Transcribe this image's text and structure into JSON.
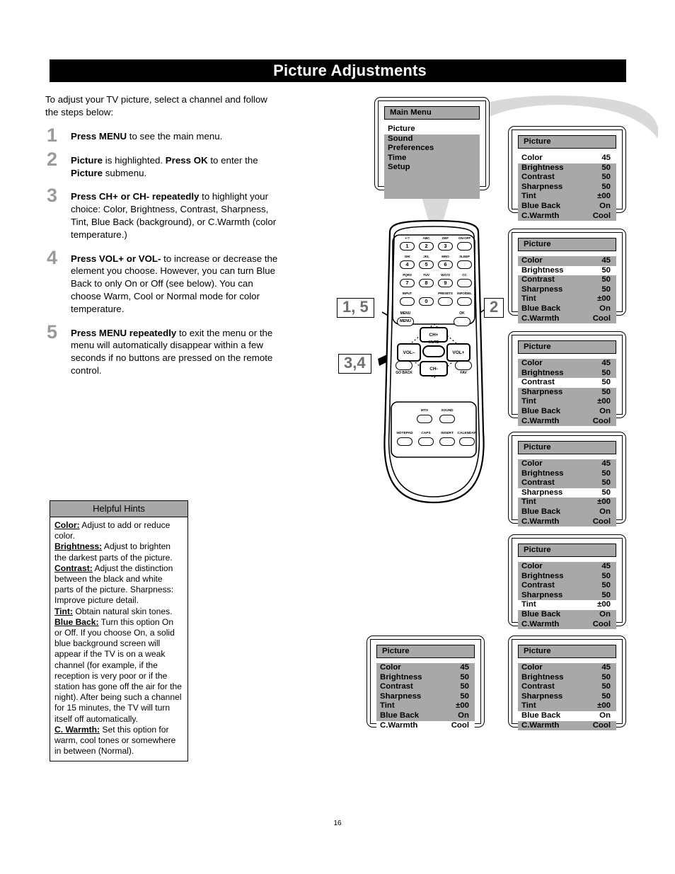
{
  "header": {
    "title": "Picture Adjustments"
  },
  "page": {
    "number": "16"
  },
  "intro": "To adjust your TV picture, select a channel and follow the steps below:",
  "steps": [
    {
      "num": "1",
      "html": "<b>Press MENU</b> to see the main menu."
    },
    {
      "num": "2",
      "html": "<b>Picture</b> is highlighted. <b>Press OK</b> to enter the <b>Picture</b> submenu."
    },
    {
      "num": "3",
      "html": "<b>Press CH+ or CH- repeatedly</b> to highlight your choice: Color, Brightness, Contrast, Sharpness, Tint, Blue Back (background), or C.Warmth (color temperature.)"
    },
    {
      "num": "4",
      "html": "<b>Press VOL+ or VOL-</b> to increase or decrease the element you choose. However, you can turn Blue Back to only On or Off (see below). You can choose Warm, Cool or Normal mode for color temperature."
    },
    {
      "num": "5",
      "html": "<b>Press MENU repeatedly</b> to exit the menu or the menu will automatically disappear within a few seconds if no buttons are pressed on the remote control."
    }
  ],
  "hints": {
    "title": "Helpful Hints",
    "html": "<u>Color:</u> Adjust to add or reduce color.<br><u>Brightness:</u> Adjust to brighten the darkest parts of the picture.<br><u>Contrast:</u> Adjust the distinction between the black and white parts of the picture. Sharpness: Improve picture detail.<br><u>Tint:</u> Obtain natural skin tones.<br><u>Blue Back:</u> Turn this option On or Off. If you choose On, a solid blue background screen will appear if the TV is on a weak channel (for example, if the reception is very poor or if the station has gone off the air for the night). After being such a channel for 15 minutes, the TV will turn itself off automatically.<br><u>C. Warmth:</u> Set this option for warm, cool tones or somewhere in between (Normal)."
  },
  "main_menu": {
    "title": "Main Menu",
    "items": [
      {
        "label": "Picture",
        "selected": true
      },
      {
        "label": "Sound",
        "selected": false
      },
      {
        "label": "Preferences",
        "selected": false
      },
      {
        "label": "Time",
        "selected": false
      },
      {
        "label": "Setup",
        "selected": false
      }
    ]
  },
  "picture_menu": {
    "title": "Picture",
    "rows": [
      {
        "label": "Color",
        "value": "45"
      },
      {
        "label": "Brightness",
        "value": "50"
      },
      {
        "label": "Contrast",
        "value": "50"
      },
      {
        "label": "Sharpness",
        "value": "50"
      },
      {
        "label": "Tint",
        "value": "±00"
      },
      {
        "label": "Blue Back",
        "value": "On"
      },
      {
        "label": "C.Warmth",
        "value": "Cool"
      }
    ]
  },
  "picture_screens": [
    {
      "id": "color",
      "selected_index": 0
    },
    {
      "id": "brightness",
      "selected_index": 1
    },
    {
      "id": "contrast",
      "selected_index": 2
    },
    {
      "id": "sharpness",
      "selected_index": 3
    },
    {
      "id": "tint",
      "selected_index": 4
    },
    {
      "id": "c-warmth",
      "selected_index": 6
    },
    {
      "id": "blue-back",
      "selected_index": 5
    }
  ],
  "callouts": [
    {
      "id": "steps-1-5",
      "label": "1, 5"
    },
    {
      "id": "step-2",
      "label": "2"
    },
    {
      "id": "steps-3-4",
      "label": "3,4"
    }
  ],
  "remote": {
    "keypad": [
      {
        "sub": "+-?",
        "key": "1"
      },
      {
        "sub": "ABC",
        "key": "2"
      },
      {
        "sub": "DEF",
        "key": "3"
      },
      {
        "sub": "ON·OFF",
        "key": ""
      },
      {
        "sub": "GHI",
        "key": "4"
      },
      {
        "sub": "JKL",
        "key": "5"
      },
      {
        "sub": "MNO",
        "key": "6"
      },
      {
        "sub": "SLEEP",
        "key": ""
      },
      {
        "sub": "PQRS",
        "key": "7"
      },
      {
        "sub": "TUV",
        "key": "8"
      },
      {
        "sub": "WXYZ",
        "key": "9"
      },
      {
        "sub": "CC",
        "key": ""
      },
      {
        "sub": "INPUT",
        "key": ""
      },
      {
        "sub": "",
        "key": "0"
      },
      {
        "sub": "PRESETS",
        "key": ""
      },
      {
        "sub": "INFO/DEL",
        "key": ""
      }
    ],
    "menu_label": "MENU",
    "ok_label": "OK",
    "ch_up_label": "CH+",
    "ch_down_label": "CH-",
    "vol_down_label": "VOL–",
    "vol_up_label": "VOL+",
    "mute_label": "MUTE",
    "go_back_label": "GO BACK",
    "fav_label": "FAV",
    "mts_label": "MTS",
    "sound_label": "SOUND",
    "notepad_label": "NOTEPAD",
    "caps_label": "CAPS",
    "insert_label": "INSERT",
    "calendar_label": "CALENDAR"
  },
  "colors": {
    "header_bg": "#000000",
    "osd_gray": "#a8a8a8",
    "step_number": "#9a9a9a",
    "deco_gray": "#d9d9d9"
  }
}
